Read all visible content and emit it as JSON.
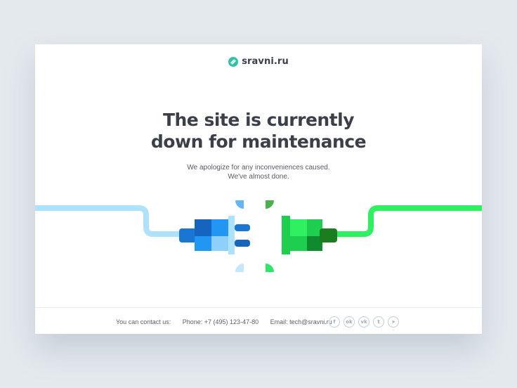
{
  "brand": {
    "name": "sravni.ru",
    "logo_icon": "sravni-logo-icon",
    "colors": {
      "blue": "#2aa0e6",
      "green": "#2ee66a",
      "dark_text": "#3a3f4a"
    }
  },
  "heading": {
    "line1": "The site is currently",
    "line2": "down for maintenance"
  },
  "message": {
    "line1": "We apologize for any inconveniences caused.",
    "line2": "We've almost done."
  },
  "illustration": {
    "left_plug_color": "#1e8fe6",
    "right_socket_color": "#22dd55"
  },
  "footer": {
    "contact_label": "You can contact us:",
    "phone": "Phone:  +7 (495) 123-47-80",
    "email": "Email: tech@sravni.ru",
    "social_icons": [
      {
        "name": "facebook-icon",
        "glyph": "f"
      },
      {
        "name": "odnoklassniki-icon",
        "glyph": "ok"
      },
      {
        "name": "vk-icon",
        "glyph": "vk"
      },
      {
        "name": "twitter-icon",
        "glyph": "t"
      },
      {
        "name": "telegram-icon",
        "glyph": "➤"
      }
    ]
  }
}
